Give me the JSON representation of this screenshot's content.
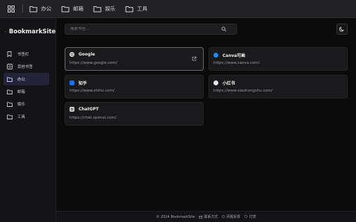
{
  "topbar": {
    "items": [
      {
        "label": "办公",
        "icon": "folder-icon"
      },
      {
        "label": "邮箱",
        "icon": "folder-icon"
      },
      {
        "label": "娱乐",
        "icon": "folder-icon"
      },
      {
        "label": "工具",
        "icon": "folder-icon"
      }
    ]
  },
  "sidebar": {
    "brand": "BookmarkSite",
    "items": [
      {
        "label": "书签栏",
        "icon": "bookmark-icon"
      },
      {
        "label": "其他书签",
        "icon": "list-icon"
      },
      {
        "label": "办公",
        "icon": "folder-icon",
        "active": true
      },
      {
        "label": "邮箱",
        "icon": "folder-icon"
      },
      {
        "label": "娱乐",
        "icon": "folder-icon"
      },
      {
        "label": "工具",
        "icon": "folder-icon"
      }
    ]
  },
  "search": {
    "placeholder": "搜索书签..."
  },
  "bookmarks": [
    {
      "title": "Google",
      "url": "https://www.google.com/",
      "icon": "google-favicon"
    },
    {
      "title": "Canva可画",
      "url": "https://www.canva.com/",
      "icon": "canva-favicon"
    },
    {
      "title": "知乎",
      "url": "https://www.zhihu.com/",
      "icon": "zhihu-favicon"
    },
    {
      "title": "小红书",
      "url": "https://www.xiaohongshu.com/",
      "icon": "xiaohongshu-favicon"
    },
    {
      "title": "ChatGPT",
      "url": "https://chat.openai.com/",
      "icon": "chatgpt-favicon"
    }
  ],
  "footer": {
    "copyright": "© 2024 BookmarkSite",
    "contact": "联系方式",
    "feedback": "问题反馈",
    "donate": "打赏"
  },
  "colors": {
    "background": "#0b0b0c",
    "sidebar": "#141416",
    "card": "#1a1a1c",
    "active_nav": "#23243a",
    "canva": "#1f8bf0",
    "zhihu": "#1772f6"
  }
}
